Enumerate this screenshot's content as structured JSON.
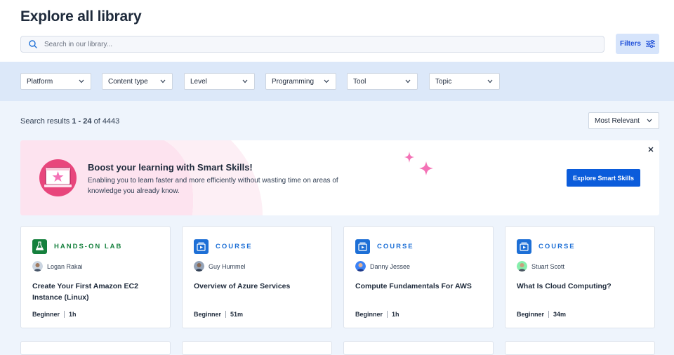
{
  "header": {
    "title": "Explore all library",
    "search_placeholder": "Search in our library...",
    "filters_label": "Filters"
  },
  "filter_bar": {
    "dropdowns": [
      {
        "label": "Platform"
      },
      {
        "label": "Content type"
      },
      {
        "label": "Level"
      },
      {
        "label": "Programming"
      },
      {
        "label": "Tool"
      },
      {
        "label": "Topic"
      }
    ]
  },
  "results": {
    "prefix": "Search results ",
    "range": "1 - 24",
    "of_text": " of ",
    "total": "4443",
    "sort_label": "Most Relevant"
  },
  "banner": {
    "title": "Boost your learning with Smart Skills!",
    "description": "Enabling you to learn faster and more efficiently without wasting time on areas of knowledge you already know.",
    "button_label": "Explore Smart Skills",
    "accent_color": "#f472b6"
  },
  "cards": [
    {
      "type": "HANDS-ON LAB",
      "type_color": "#15803d",
      "icon": "flask-icon",
      "author": "Logan Rakai",
      "title": "Create Your First Amazon EC2 Instance (Linux)",
      "level": "Beginner",
      "duration": "1h"
    },
    {
      "type": "COURSE",
      "type_color": "#1d6fd6",
      "icon": "course-play-icon",
      "author": "Guy Hummel",
      "title": "Overview of Azure Services",
      "level": "Beginner",
      "duration": "51m"
    },
    {
      "type": "COURSE",
      "type_color": "#1d6fd6",
      "icon": "course-play-icon",
      "author": "Danny Jessee",
      "title": "Compute Fundamentals For AWS",
      "level": "Beginner",
      "duration": "1h"
    },
    {
      "type": "COURSE",
      "type_color": "#1d6fd6",
      "icon": "course-play-icon",
      "author": "Stuart Scott",
      "title": "What Is Cloud Computing?",
      "level": "Beginner",
      "duration": "34m"
    }
  ],
  "colors": {
    "primary": "#0b5cdb",
    "lab_green": "#15803d",
    "course_blue": "#1d6fd6",
    "filter_bar_bg": "#dce8f9"
  }
}
